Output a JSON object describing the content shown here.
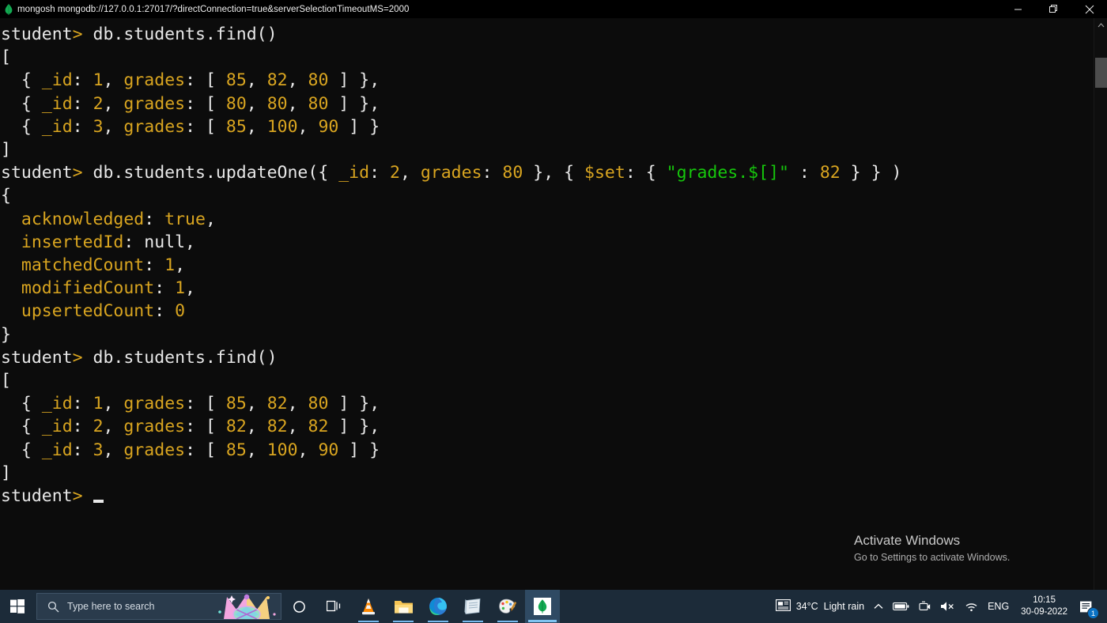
{
  "window": {
    "icon": "mongodb-leaf-icon",
    "title": "mongosh mongodb://127.0.0.1:27017/?directConnection=true&serverSelectionTimeoutMS=2000",
    "minimize_label": "Minimize",
    "maximize_label": "Restore",
    "close_label": "Close"
  },
  "theme": {
    "terminal_bg": "#0c0c0c",
    "text": "#e8e8e8",
    "amber": "#d9a520",
    "green": "#16c60c",
    "taskbar_bg": "#1c2b39",
    "accent": "#0a72c4"
  },
  "terminal": {
    "prompt": "student>",
    "prompt_word": "student",
    "prompt_caret": ">",
    "cursor": "_",
    "lines": [
      {
        "id": "l1",
        "type": "prompt",
        "command": " db.students.find()"
      },
      {
        "id": "l2",
        "type": "output",
        "text": "["
      },
      {
        "id": "l3",
        "type": "doc",
        "text": "  { _id: 1, grades: [ 85, 82, 80 ] },"
      },
      {
        "id": "l4",
        "type": "doc",
        "text": "  { _id: 2, grades: [ 80, 80, 80 ] },"
      },
      {
        "id": "l5",
        "type": "doc",
        "text": "  { _id: 3, grades: [ 85, 100, 90 ] }"
      },
      {
        "id": "l6",
        "type": "output",
        "text": "]"
      },
      {
        "id": "l7",
        "type": "prompt",
        "command": " db.students.updateOne({ _id: 2, grades: 80 }, { $set: { \"grades.$[]\" : 82 } } )"
      },
      {
        "id": "l8",
        "type": "output",
        "text": "{"
      },
      {
        "id": "l9",
        "type": "kv",
        "text": "  acknowledged: true,"
      },
      {
        "id": "l10",
        "type": "kv",
        "text": "  insertedId: null,"
      },
      {
        "id": "l11",
        "type": "kv",
        "text": "  matchedCount: 1,"
      },
      {
        "id": "l12",
        "type": "kv",
        "text": "  modifiedCount: 1,"
      },
      {
        "id": "l13",
        "type": "kv",
        "text": "  upsertedCount: 0"
      },
      {
        "id": "l14",
        "type": "output",
        "text": "}"
      },
      {
        "id": "l15",
        "type": "prompt",
        "command": " db.students.find()"
      },
      {
        "id": "l16",
        "type": "output",
        "text": "["
      },
      {
        "id": "l17",
        "type": "doc",
        "text": "  { _id: 1, grades: [ 85, 82, 80 ] },"
      },
      {
        "id": "l18",
        "type": "doc",
        "text": "  { _id: 2, grades: [ 82, 82, 82 ] },"
      },
      {
        "id": "l19",
        "type": "doc",
        "text": "  { _id: 3, grades: [ 85, 100, 90 ] }"
      },
      {
        "id": "l20",
        "type": "output",
        "text": "]"
      },
      {
        "id": "l21",
        "type": "cursor",
        "command": ""
      }
    ],
    "data_before": [
      {
        "_id": 1,
        "grades": [
          85,
          82,
          80
        ]
      },
      {
        "_id": 2,
        "grades": [
          80,
          80,
          80
        ]
      },
      {
        "_id": 3,
        "grades": [
          85,
          100,
          90
        ]
      }
    ],
    "update_result": {
      "acknowledged": "true",
      "insertedId": "null",
      "matchedCount": "1",
      "modifiedCount": "1",
      "upsertedCount": "0"
    },
    "data_after": [
      {
        "_id": 1,
        "grades": [
          85,
          82,
          80
        ]
      },
      {
        "_id": 2,
        "grades": [
          82,
          82,
          82
        ]
      },
      {
        "_id": 3,
        "grades": [
          85,
          100,
          90
        ]
      }
    ]
  },
  "watermark": {
    "title": "Activate Windows",
    "subtitle": "Go to Settings to activate Windows."
  },
  "taskbar": {
    "start_label": "Start",
    "search_placeholder": "Type here to search",
    "apps": [
      {
        "name": "task-view",
        "label": "Task View"
      },
      {
        "name": "cortana",
        "label": "Cortana"
      },
      {
        "name": "vlc",
        "label": "VLC media player"
      },
      {
        "name": "file-explorer",
        "label": "File Explorer"
      },
      {
        "name": "microsoft-edge",
        "label": "Microsoft Edge"
      },
      {
        "name": "notepad",
        "label": "Notepad"
      },
      {
        "name": "paint",
        "label": "Paint"
      },
      {
        "name": "mongodb",
        "label": "MongoDB Compass"
      }
    ],
    "tray": {
      "weather_temp": "34°C",
      "weather_desc": "Light rain",
      "show_hidden": "^",
      "language": "ENG",
      "time": "10:15",
      "date": "30-09-2022",
      "notification_count": "1"
    }
  }
}
